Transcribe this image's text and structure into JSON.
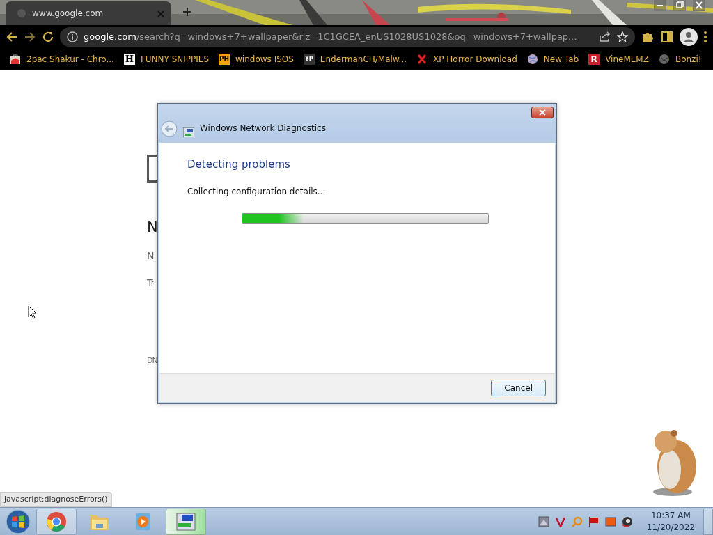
{
  "browser": {
    "tab": {
      "title": "www.google.com"
    },
    "address": {
      "host": "google.com",
      "path": "/search?q=windows+7+wallpaper&rlz=1C1GCEA_enUS1028US1028&oq=windows+7+wallpap..."
    },
    "bookmarks": [
      {
        "kind": "bag",
        "label": "2pac Shakur - Chro..."
      },
      {
        "kind": "letter",
        "badge": "H",
        "label": "FUNNY SNIPPIES"
      },
      {
        "kind": "orange",
        "badge": "PH",
        "label": "windows ISOS"
      },
      {
        "kind": "dark",
        "badge": "YP",
        "label": "EndermanCH/Malw..."
      },
      {
        "kind": "cross",
        "label": "XP Horror Download"
      },
      {
        "kind": "globe",
        "label": "New Tab"
      },
      {
        "kind": "red",
        "badge": "R",
        "label": "VineMEMZ"
      },
      {
        "kind": "grey",
        "label": "Bonzi!"
      }
    ],
    "status_url": "javascript:diagnoseErrors()"
  },
  "page": {
    "heading": "N",
    "lines": [
      "N",
      "Tr"
    ],
    "footer": "DN"
  },
  "dialog": {
    "title": "Windows Network Diagnostics",
    "heading": "Detecting problems",
    "status": "Collecting configuration details...",
    "progress": {
      "level": 0.25
    },
    "buttons": [
      "Cancel"
    ]
  },
  "taskbar": {
    "apps": [
      {
        "kind": "chrome",
        "running": true,
        "selected": false
      },
      {
        "kind": "folder",
        "running": false,
        "selected": false
      },
      {
        "kind": "media",
        "running": false,
        "selected": false
      },
      {
        "kind": "network",
        "running": true,
        "selected": true
      }
    ],
    "clock": {
      "time": "10:37 AM",
      "date": "11/20/2022"
    }
  }
}
